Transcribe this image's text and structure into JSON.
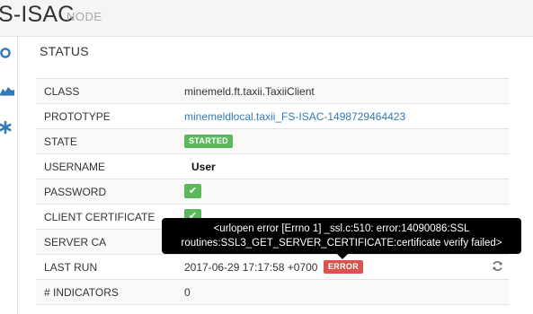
{
  "header": {
    "title": "S-ISAC",
    "subtitle": "NODE"
  },
  "sidebar": {
    "items": [
      {
        "icon": "circle-icon"
      },
      {
        "icon": "area-chart-icon"
      },
      {
        "icon": "asterisk-icon"
      }
    ]
  },
  "panel": {
    "title": "STATUS"
  },
  "rows": {
    "class": {
      "label": "CLASS",
      "value": "minemeld.ft.taxii.TaxiiClient"
    },
    "prototype": {
      "label": "PROTOTYPE",
      "value": "minemeldlocal.taxii_FS-ISAC-1498729464423"
    },
    "state": {
      "label": "STATE",
      "value": "STARTED"
    },
    "username": {
      "label": "USERNAME",
      "value": "User"
    },
    "password": {
      "label": "PASSWORD",
      "value": "✔"
    },
    "client_certificate": {
      "label": "CLIENT CERTIFICATE",
      "value": "✔"
    },
    "server_ca": {
      "label": "SERVER CA"
    },
    "last_run": {
      "label": "LAST RUN",
      "value": "2017-06-29 17:17:58 +0700",
      "status": "ERROR"
    },
    "indicators": {
      "label": "# INDICATORS",
      "value": "0"
    }
  },
  "tooltip": {
    "line1": "<urlopen error [Errno 1] _ssl.c:510: error:14090086:SSL",
    "line2": "routines:SSL3_GET_SERVER_CERTIFICATE:certificate verify failed>"
  },
  "colors": {
    "success": "#5cb85c",
    "danger": "#d9534f",
    "link": "#337ab7"
  }
}
